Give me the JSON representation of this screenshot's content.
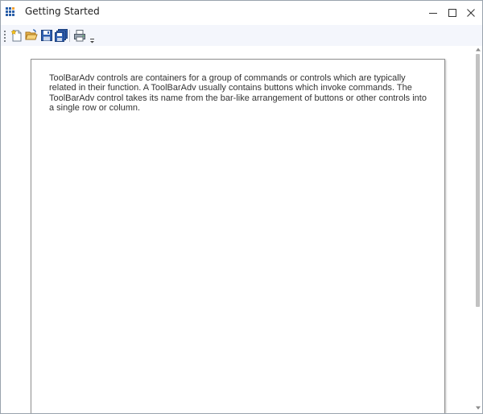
{
  "window": {
    "title": "Getting Started",
    "app_icon": "app-grid-icon"
  },
  "caption_buttons": {
    "minimize_icon": "minimize-icon",
    "maximize_icon": "maximize-icon",
    "close_icon": "close-icon"
  },
  "toolbar": {
    "items": [
      {
        "name": "new",
        "icon": "new-document-icon"
      },
      {
        "name": "open",
        "icon": "open-folder-icon"
      },
      {
        "name": "save",
        "icon": "save-icon"
      },
      {
        "name": "save-all",
        "icon": "save-all-icon"
      },
      {
        "name": "print",
        "icon": "print-icon"
      }
    ],
    "overflow_icon": "overflow-dropdown-icon"
  },
  "document": {
    "text": "ToolBarAdv controls are containers for a group of commands or controls which are typically related in their function. A ToolBarAdv usually contains buttons which invoke commands. The ToolBarAdv control takes its name from the bar-like arrangement of buttons or other controls into a single row or column."
  },
  "colors": {
    "toolbar_bg": "#f4f6fc",
    "icon_blue": "#2a5fa8",
    "icon_orange": "#f0a030"
  }
}
